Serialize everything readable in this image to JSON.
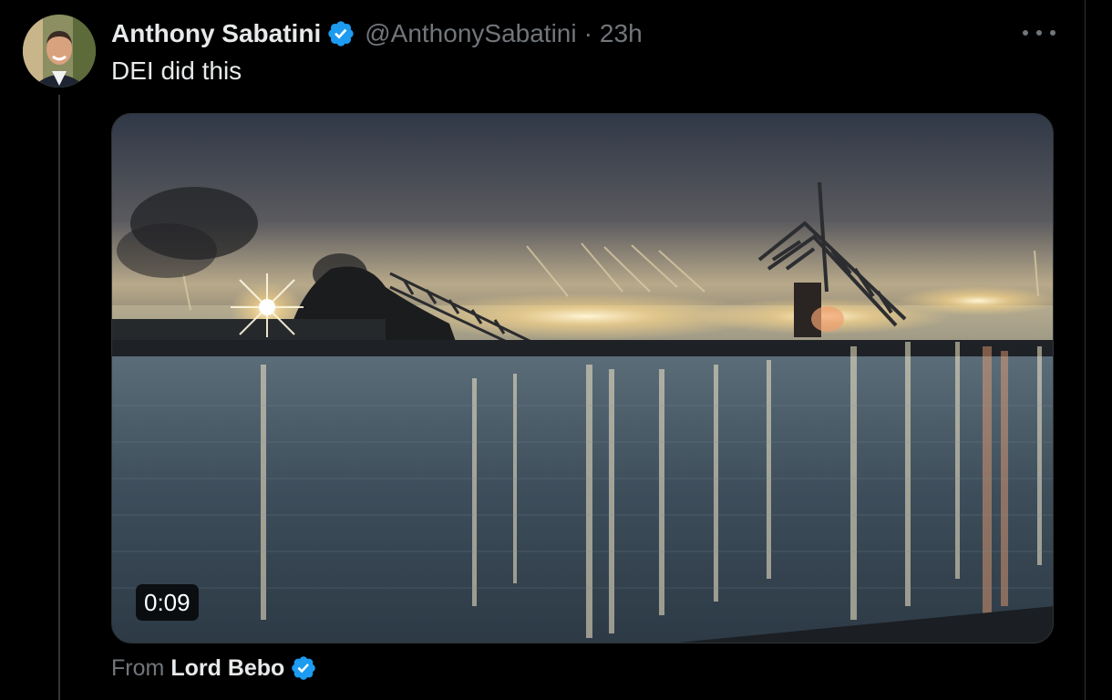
{
  "tweet": {
    "author_name": "Anthony Sabatini",
    "handle": "@AnthonySabatini",
    "separator": "·",
    "time": "23h",
    "text": "DEI did this",
    "more_icon": "more-horizontal-icon",
    "verified_icon": "verified-badge-icon"
  },
  "media": {
    "type": "video",
    "duration": "0:09"
  },
  "attribution": {
    "label": "From",
    "name": "Lord Bebo",
    "verified_icon": "verified-badge-icon"
  },
  "colors": {
    "background": "#000000",
    "text_primary": "#e7e9ea",
    "text_secondary": "#71767b",
    "verified_blue": "#1d9bf0",
    "border": "#2f3336"
  }
}
